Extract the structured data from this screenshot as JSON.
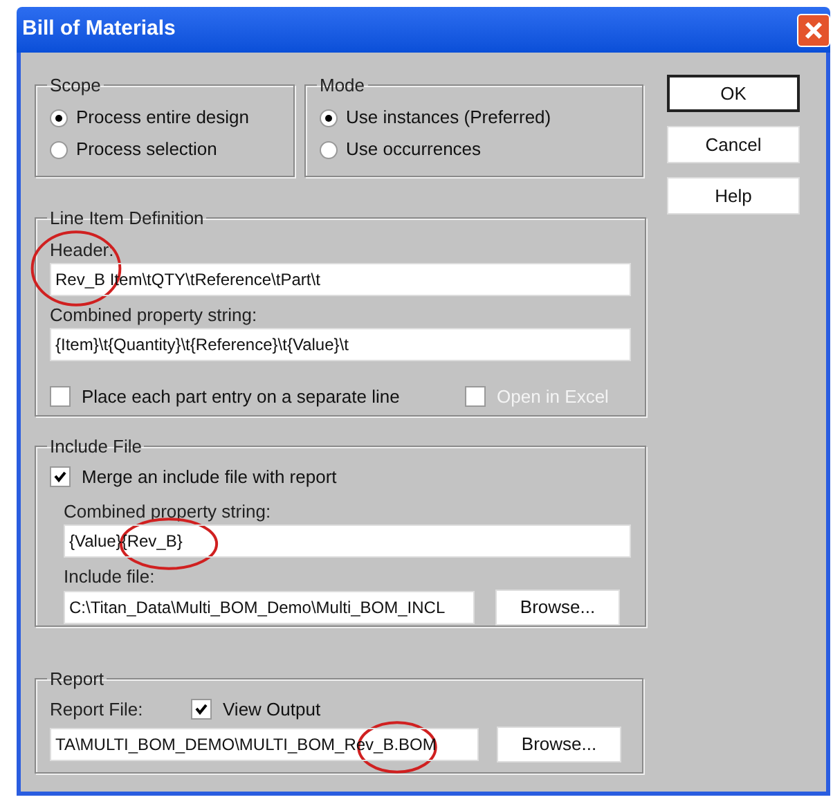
{
  "window": {
    "title": "Bill of Materials"
  },
  "scope": {
    "title": "Scope",
    "options": [
      {
        "label": "Process entire design",
        "selected": true
      },
      {
        "label": "Process selection",
        "selected": false
      }
    ]
  },
  "mode": {
    "title": "Mode",
    "options": [
      {
        "label": "Use instances (Preferred)",
        "selected": true
      },
      {
        "label": "Use occurrences",
        "selected": false
      }
    ]
  },
  "buttons": [
    {
      "label": "OK",
      "default": true
    },
    {
      "label": "Cancel",
      "default": false
    },
    {
      "label": "Help",
      "default": false
    }
  ],
  "line_item_definition": {
    "title": "Line Item Definition",
    "header_label": "Header:",
    "header_value": "Rev_B Item\\tQTY\\tReference\\tPart\\t",
    "combined_label": "Combined property string:",
    "combined_value": "{Item}\\t{Quantity}\\t{Reference}\\t{Value}\\t",
    "options": [
      {
        "label": "Place each part entry on a separate line",
        "checked": false,
        "disabled": false
      },
      {
        "label": "Open in Excel",
        "checked": false,
        "disabled": true
      }
    ]
  },
  "include_file": {
    "title": "Include File",
    "merge": {
      "label": "Merge an include file with report",
      "checked": true
    },
    "combined_label": "Combined property string:",
    "combined_value": "{Value}{Rev_B}",
    "file_label": "Include file:",
    "file_value": "C:\\Titan_Data\\Multi_BOM_Demo\\Multi_BOM_INCL",
    "browse": "Browse..."
  },
  "report": {
    "title": "Report",
    "file_label": "Report File:",
    "view_output": {
      "label": "View Output",
      "checked": true
    },
    "file_value": "TA\\MULTI_BOM_DEMO\\MULTI_BOM_Rev_B.BOM",
    "browse": "Browse..."
  }
}
